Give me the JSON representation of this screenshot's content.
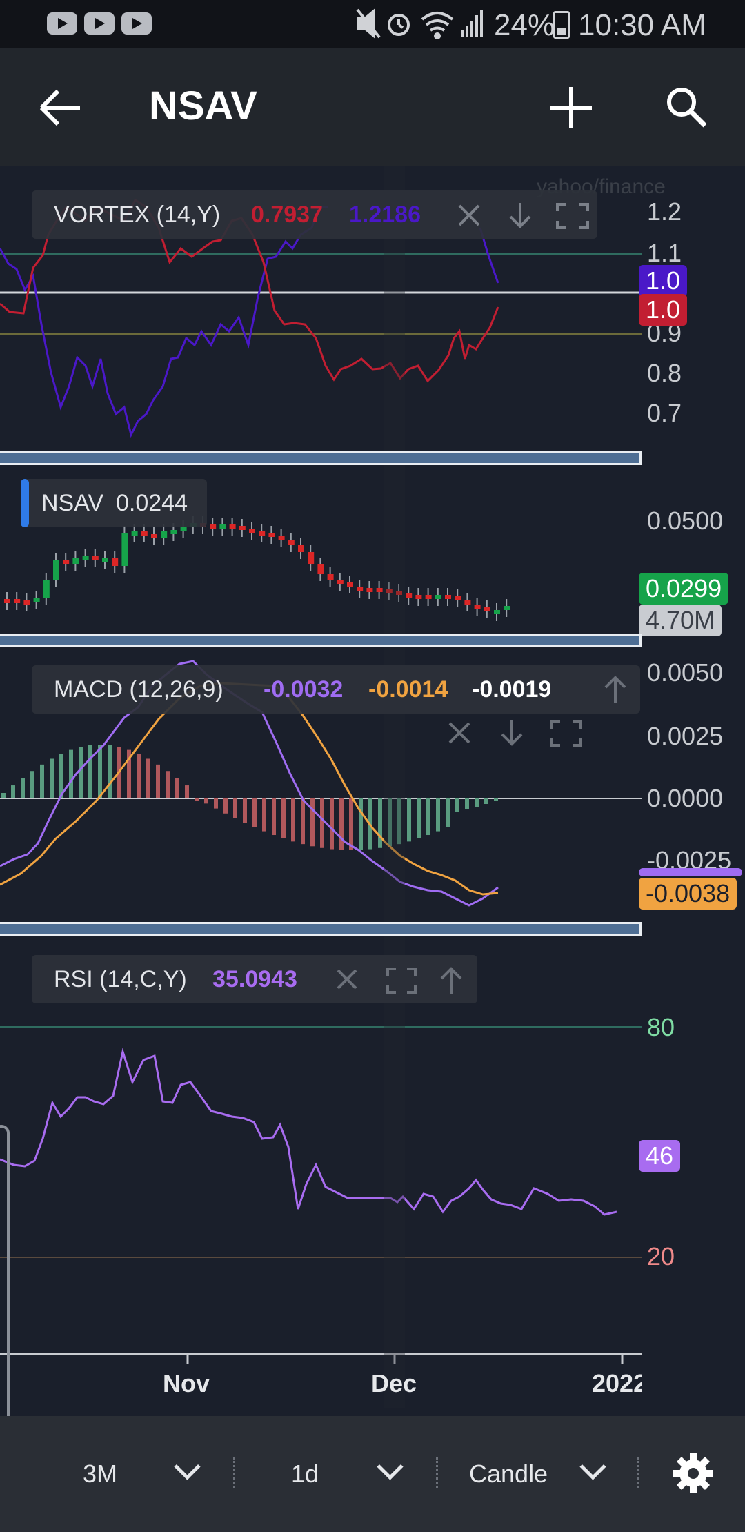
{
  "status_bar": {
    "battery": "24%",
    "time": "10:30 AM"
  },
  "header": {
    "title": "NSAV"
  },
  "vortex": {
    "label": "VORTEX (14,Y)",
    "value_minus": "0.7937",
    "value_plus": "1.2186",
    "axis_ticks": [
      "1.2",
      "1.1",
      "0.9",
      "0.8",
      "0.7"
    ],
    "badge_plus": "1.0",
    "badge_minus": "1.0",
    "watermark": "yahoo/finance"
  },
  "price": {
    "label": "NSAV",
    "value": "0.0244",
    "axis_tick": "0.0500",
    "badge_price": "0.0299",
    "badge_volume": "4.70M"
  },
  "macd": {
    "label": "MACD (12,26,9)",
    "v1": "-0.0032",
    "v2": "-0.0014",
    "v3": "-0.0019",
    "axis_ticks": [
      "0.0050",
      "0.0025",
      "0.0000",
      "-0.0025"
    ],
    "badge": "-0.0038"
  },
  "rsi": {
    "label": "RSI (14,C,Y)",
    "value": "35.0943",
    "upper": "80",
    "lower": "20",
    "badge": "46"
  },
  "x_axis": {
    "labels": [
      "Nov",
      "Dec",
      "2022"
    ]
  },
  "bottom_bar": {
    "range": "3M",
    "interval": "1d",
    "chart_type": "Candle"
  },
  "colors": {
    "background": "#1a1f2b",
    "vortex_plus": "#4a18c8",
    "vortex_minus": "#c21e32",
    "macd_line": "#9f6cf2",
    "signal_line": "#f0a341",
    "rsi_line": "#a86cf0",
    "up": "#16a34a",
    "down": "#dc2626"
  },
  "icons": [
    "youtube-icon",
    "mute-icon",
    "alarm-icon",
    "wifi-icon",
    "signal-icon",
    "battery-icon",
    "back-arrow-icon",
    "plus-icon",
    "search-icon",
    "close-icon",
    "arrow-down-icon",
    "expand-icon",
    "arrow-up-icon",
    "chevron-down-icon",
    "gear-icon"
  ]
}
